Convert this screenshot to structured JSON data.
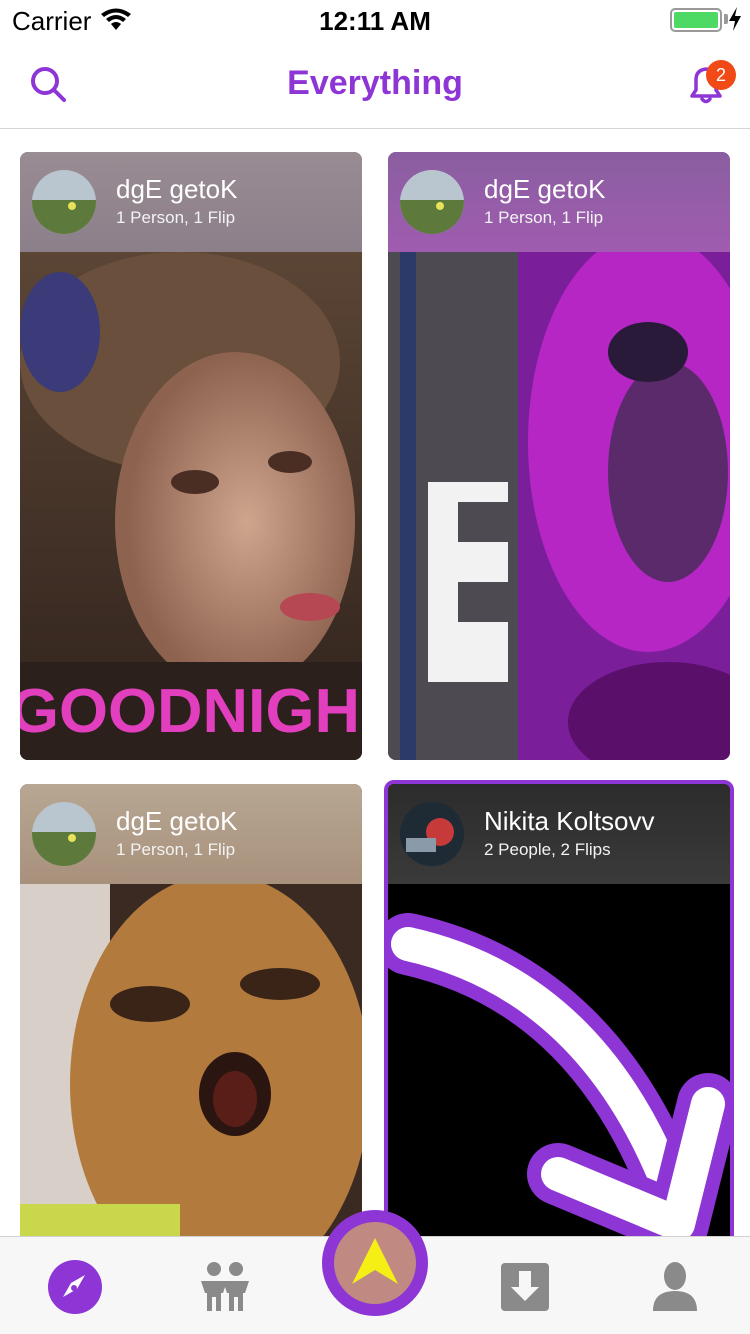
{
  "status_bar": {
    "carrier": "Carrier",
    "time": "12:11 AM",
    "battery_level": 1.0
  },
  "nav": {
    "title": "Everything",
    "notification_count": "2",
    "search_icon": "search-icon",
    "bell_icon": "bell-icon"
  },
  "cards": [
    {
      "name": "dgE getoK",
      "meta": "1 Person, 1 Flip",
      "media_text": "GOODNIGH"
    },
    {
      "name": "dgE getoK",
      "meta": "1 Person, 1 Flip"
    },
    {
      "name": "dgE getoK",
      "meta": "1 Person, 1 Flip"
    },
    {
      "name": "Nikita Koltsovv",
      "meta": "2 People, 2 Flips"
    }
  ],
  "tabs": {
    "explore_icon": "compass-icon",
    "people_icon": "people-icon",
    "create_icon": "arrow-up-icon",
    "download_icon": "download-icon",
    "profile_icon": "profile-icon"
  },
  "colors": {
    "accent": "#8e35d6",
    "badge": "#f24a16",
    "battery": "#4cd964"
  }
}
